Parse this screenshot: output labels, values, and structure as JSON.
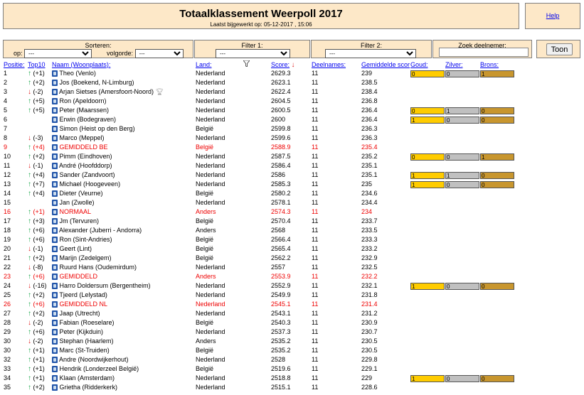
{
  "header": {
    "title": "Totaalklassement Weerpoll 2017",
    "subtitle": "Laatst bijgewerkt op: 05-12-2017 , 15:06",
    "help_label": "Help"
  },
  "controls": {
    "sort_label": "Sorteren:",
    "op_label": "op:",
    "op_value": "---",
    "volgorde_label": "volgorde:",
    "volgorde_value": "---",
    "filter1_label": "Filter 1:",
    "filter1_value": "---",
    "filter2_label": "Filter 2:",
    "filter2_value": "---",
    "zoek_label": "Zoek deelnemer:",
    "zoek_value": "",
    "toon_label": "Toon"
  },
  "columns": {
    "positie": "Positie:",
    "top10": "Top10",
    "naam": "Naam (Woonplaats):",
    "land": "Land:",
    "score": "Score:",
    "deelnames": "Deelnames:",
    "gem": "Gemiddelde score:",
    "goud": "Goud:",
    "zilver": "Zilver:",
    "brons": "Brons:"
  },
  "rows": [
    {
      "pos": "1",
      "dir": "up",
      "chg": "(+1)",
      "name": "Theo (Venlo)",
      "land": "Nederland",
      "score": "2629.3",
      "deel": "11",
      "gem": "239",
      "medals": [
        "0",
        "0",
        "1"
      ]
    },
    {
      "pos": "2",
      "dir": "up",
      "chg": "(+2)",
      "name": "Jos (Boekend, N-Limburg)",
      "land": "Nederland",
      "score": "2623.1",
      "deel": "11",
      "gem": "238.5"
    },
    {
      "pos": "3",
      "dir": "down",
      "chg": "(-2)",
      "name": "Arjan Sietses (Amersfoort-Noord)",
      "land": "Nederland",
      "score": "2622.4",
      "deel": "11",
      "gem": "238.4",
      "trophy": true
    },
    {
      "pos": "4",
      "dir": "up",
      "chg": "(+5)",
      "name": "Ron (Apeldoorn)",
      "land": "Nederland",
      "score": "2604.5",
      "deel": "11",
      "gem": "236.8"
    },
    {
      "pos": "5",
      "dir": "up",
      "chg": "(+5)",
      "name": "Peter (Maarssen)",
      "land": "Nederland",
      "score": "2600.5",
      "deel": "11",
      "gem": "236.4",
      "medals": [
        "0",
        "1",
        "0"
      ]
    },
    {
      "pos": "6",
      "dir": "",
      "chg": "",
      "name": "Erwin (Bodegraven)",
      "land": "Nederland",
      "score": "2600",
      "deel": "11",
      "gem": "236.4",
      "medals": [
        "1",
        "0",
        "0"
      ]
    },
    {
      "pos": "7",
      "dir": "",
      "chg": "",
      "name": "Simon (Heist op den Berg)",
      "land": "België",
      "score": "2599.8",
      "deel": "11",
      "gem": "236.3"
    },
    {
      "pos": "8",
      "dir": "down",
      "chg": "(-3)",
      "name": "Marco (Meppel)",
      "land": "Nederland",
      "score": "2599.6",
      "deel": "11",
      "gem": "236.3"
    },
    {
      "pos": "9",
      "dir": "up",
      "chg": "(+4)",
      "name": "GEMIDDELD BE",
      "land": "België",
      "score": "2588.9",
      "deel": "11",
      "gem": "235.4",
      "red": true
    },
    {
      "pos": "10",
      "dir": "up",
      "chg": "(+2)",
      "name": "Pimm (Eindhoven)",
      "land": "Nederland",
      "score": "2587.5",
      "deel": "11",
      "gem": "235.2",
      "medals": [
        "0",
        "0",
        "1"
      ]
    },
    {
      "pos": "11",
      "dir": "down",
      "chg": "(-1)",
      "name": "André (Hoofddorp)",
      "land": "Nederland",
      "score": "2586.4",
      "deel": "11",
      "gem": "235.1"
    },
    {
      "pos": "12",
      "dir": "up",
      "chg": "(+4)",
      "name": "Sander (Zandvoort)",
      "land": "Nederland",
      "score": "2586",
      "deel": "11",
      "gem": "235.1",
      "medals": [
        "1",
        "1",
        "0"
      ]
    },
    {
      "pos": "13",
      "dir": "up",
      "chg": "(+7)",
      "name": "Michael (Hoogeveen)",
      "land": "Nederland",
      "score": "2585.3",
      "deel": "11",
      "gem": "235",
      "medals": [
        "1",
        "0",
        "0"
      ]
    },
    {
      "pos": "14",
      "dir": "up",
      "chg": "(+4)",
      "name": "Dieter (Veurne)",
      "land": "België",
      "score": "2580.2",
      "deel": "11",
      "gem": "234.6"
    },
    {
      "pos": "15",
      "dir": "",
      "chg": "",
      "name": "Jan (Zwolle)",
      "land": "Nederland",
      "score": "2578.1",
      "deel": "11",
      "gem": "234.4"
    },
    {
      "pos": "16",
      "dir": "up",
      "chg": "(+1)",
      "name": "NORMAAL",
      "land": "Anders",
      "score": "2574.3",
      "deel": "11",
      "gem": "234",
      "red": true
    },
    {
      "pos": "17",
      "dir": "up",
      "chg": "(+3)",
      "name": "Jm (Tervuren)",
      "land": "België",
      "score": "2570.4",
      "deel": "11",
      "gem": "233.7"
    },
    {
      "pos": "18",
      "dir": "up",
      "chg": "(+6)",
      "name": "Alexander (Juberri - Andorra)",
      "land": "Anders",
      "score": "2568",
      "deel": "11",
      "gem": "233.5"
    },
    {
      "pos": "19",
      "dir": "up",
      "chg": "(+6)",
      "name": "Ron (Sint-Andries)",
      "land": "België",
      "score": "2566.4",
      "deel": "11",
      "gem": "233.3"
    },
    {
      "pos": "20",
      "dir": "down",
      "chg": "(-1)",
      "name": "Geert (Lint)",
      "land": "België",
      "score": "2565.4",
      "deel": "11",
      "gem": "233.2"
    },
    {
      "pos": "21",
      "dir": "up",
      "chg": "(+2)",
      "name": "Marijn (Zedelgem)",
      "land": "België",
      "score": "2562.2",
      "deel": "11",
      "gem": "232.9"
    },
    {
      "pos": "22",
      "dir": "down",
      "chg": "(-8)",
      "name": "Ruurd Hans (Oudemirdum)",
      "land": "Nederland",
      "score": "2557",
      "deel": "11",
      "gem": "232.5"
    },
    {
      "pos": "23",
      "dir": "up",
      "chg": "(+6)",
      "name": "GEMIDDELD",
      "land": "Anders",
      "score": "2553.9",
      "deel": "11",
      "gem": "232.2",
      "red": true
    },
    {
      "pos": "24",
      "dir": "down",
      "chg": "(-16)",
      "name": "Harro Doldersum (Bergentheim)",
      "land": "Nederland",
      "score": "2552.9",
      "deel": "11",
      "gem": "232.1",
      "medals": [
        "1",
        "0",
        "0"
      ]
    },
    {
      "pos": "25",
      "dir": "up",
      "chg": "(+2)",
      "name": "Tjeerd (Lelystad)",
      "land": "Nederland",
      "score": "2549.9",
      "deel": "11",
      "gem": "231.8"
    },
    {
      "pos": "26",
      "dir": "up",
      "chg": "(+6)",
      "name": "GEMIDDELD NL",
      "land": "Nederland",
      "score": "2545.1",
      "deel": "11",
      "gem": "231.4",
      "red": true
    },
    {
      "pos": "27",
      "dir": "up",
      "chg": "(+2)",
      "name": "Jaap (Utrecht)",
      "land": "Nederland",
      "score": "2543.1",
      "deel": "11",
      "gem": "231.2"
    },
    {
      "pos": "28",
      "dir": "down",
      "chg": "(-2)",
      "name": "Fabian (Roeselare)",
      "land": "België",
      "score": "2540.3",
      "deel": "11",
      "gem": "230.9"
    },
    {
      "pos": "29",
      "dir": "up",
      "chg": "(+6)",
      "name": "Peter (Kijkduin)",
      "land": "Nederland",
      "score": "2537.3",
      "deel": "11",
      "gem": "230.7"
    },
    {
      "pos": "30",
      "dir": "down",
      "chg": "(-2)",
      "name": "Stephan (Haarlem)",
      "land": "Anders",
      "score": "2535.2",
      "deel": "11",
      "gem": "230.5"
    },
    {
      "pos": "30",
      "dir": "up",
      "chg": "(+1)",
      "name": "Marc (St-Truiden)",
      "land": "België",
      "score": "2535.2",
      "deel": "11",
      "gem": "230.5"
    },
    {
      "pos": "32",
      "dir": "up",
      "chg": "(+1)",
      "name": "Andre (Noordwijkerhout)",
      "land": "Nederland",
      "score": "2528",
      "deel": "11",
      "gem": "229.8"
    },
    {
      "pos": "33",
      "dir": "up",
      "chg": "(+1)",
      "name": "Hendrik (Londerzeel België)",
      "land": "België",
      "score": "2519.6",
      "deel": "11",
      "gem": "229.1"
    },
    {
      "pos": "34",
      "dir": "up",
      "chg": "(+1)",
      "name": "Klaan (Amsterdam)",
      "land": "Nederland",
      "score": "2518.8",
      "deel": "11",
      "gem": "229",
      "medals": [
        "1",
        "0",
        "0"
      ]
    },
    {
      "pos": "35",
      "dir": "up",
      "chg": "(+2)",
      "name": "Grietha (Ridderkerk)",
      "land": "Nederland",
      "score": "2515.1",
      "deel": "11",
      "gem": "228.6"
    }
  ],
  "icons": {
    "up": "arrow-up-icon",
    "down": "arrow-down-icon",
    "person": "person-icon",
    "trophy": "trophy-icon",
    "filter": "filter-icon"
  },
  "colors": {
    "panel_bg": "#fde8c8",
    "gold": "#ffcc00",
    "silver": "#c0c0c0",
    "bronze": "#c8962e",
    "up": "#1aa84a",
    "down": "#e02222",
    "highlight": "#e00000"
  }
}
